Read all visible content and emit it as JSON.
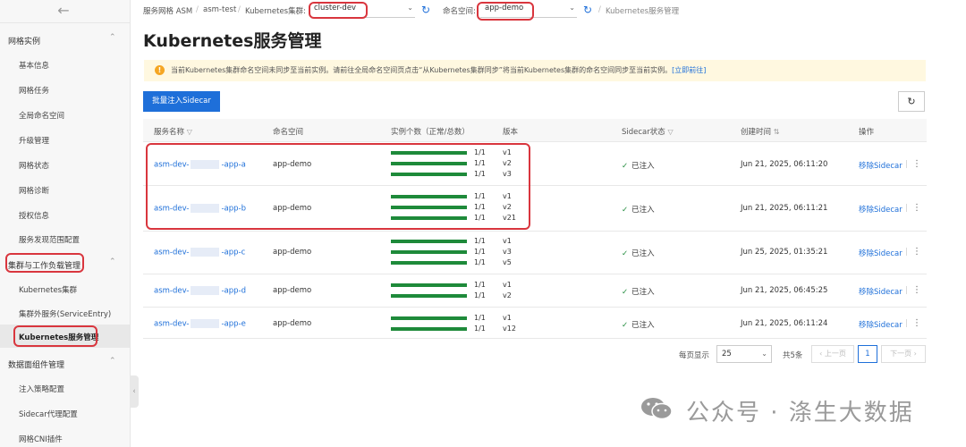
{
  "sidebar": {
    "groups": [
      {
        "label": "网格实例",
        "items": [
          "基本信息",
          "网格任务",
          "全局命名空间",
          "升级管理",
          "网格状态",
          "网格诊断",
          "授权信息",
          "服务发现范围配置"
        ]
      },
      {
        "label": "集群与工作负载管理",
        "items": [
          "Kubernetes集群",
          "集群外服务(ServiceEntry)",
          "Kubernetes服务管理"
        ]
      },
      {
        "label": "数据面组件管理",
        "items": [
          "注入策略配置",
          "Sidecar代理配置",
          "网格CNI插件"
        ]
      }
    ],
    "active_item": "Kubernetes服务管理"
  },
  "header": {
    "breadcrumb": [
      "服务网格 ASM",
      "asm-test",
      "Kubernetes集群:"
    ],
    "cluster_value": "cluster-dev",
    "namespace_label": "命名空间:",
    "namespace_value": "app-demo",
    "current_page": "Kubernetes服务管理"
  },
  "page": {
    "title": "Kubernetes服务管理",
    "notice_text": "当前Kubernetes集群命名空间未同步至当前实例。请前往全局命名空间页点击“从Kubernetes集群同步”将当前Kubernetes集群的命名空间同步至当前实例。",
    "notice_link": "[立即前往]",
    "batch_button": "批量注入Sidecar"
  },
  "table": {
    "columns": [
      "服务名称",
      "命名空间",
      "实例个数（正常/总数）",
      "版本",
      "Sidecar状态",
      "创建时间",
      "操作"
    ],
    "rows": [
      {
        "name_prefix": "asm-dev-",
        "name_suffix": "-app-a",
        "namespace": "app-demo",
        "instances": [
          "1/1",
          "1/1",
          "1/1"
        ],
        "versions": [
          "v1",
          "v2",
          "v3"
        ],
        "sidecar": "已注入",
        "created": "Jun 21, 2025, 06:11:20",
        "action": "移除Sidecar"
      },
      {
        "name_prefix": "asm-dev-",
        "name_suffix": "-app-b",
        "namespace": "app-demo",
        "instances": [
          "1/1",
          "1/1",
          "1/1"
        ],
        "versions": [
          "v1",
          "v2",
          "v21"
        ],
        "sidecar": "已注入",
        "created": "Jun 21, 2025, 06:11:21",
        "action": "移除Sidecar"
      },
      {
        "name_prefix": "asm-dev-",
        "name_suffix": "-app-c",
        "namespace": "app-demo",
        "instances": [
          "1/1",
          "1/1",
          "1/1"
        ],
        "versions": [
          "v1",
          "v3",
          "v5"
        ],
        "sidecar": "已注入",
        "created": "Jun 25, 2025, 01:35:21",
        "action": "移除Sidecar"
      },
      {
        "name_prefix": "asm-dev-",
        "name_suffix": "-app-d",
        "namespace": "app-demo",
        "instances": [
          "1/1",
          "1/1"
        ],
        "versions": [
          "v1",
          "v2"
        ],
        "sidecar": "已注入",
        "created": "Jun 21, 2025, 06:45:25",
        "action": "移除Sidecar"
      },
      {
        "name_prefix": "asm-dev-",
        "name_suffix": "-app-e",
        "namespace": "app-demo",
        "instances": [
          "1/1",
          "1/1"
        ],
        "versions": [
          "v1",
          "v12"
        ],
        "sidecar": "已注入",
        "created": "Jun 21, 2025, 06:11:24",
        "action": "移除Sidecar"
      }
    ]
  },
  "pagination": {
    "per_page_label": "每页显示",
    "per_page_value": "25",
    "total_label": "共5条",
    "prev_label": "上一页",
    "current_page": "1",
    "next_label": "下一页"
  },
  "watermark": {
    "text": "公众号 · 涤生大数据"
  },
  "colors": {
    "accent": "#1e6fd9",
    "success": "#1e8a3a",
    "highlight": "#d9363e",
    "notice_bg": "#fff8e0"
  }
}
